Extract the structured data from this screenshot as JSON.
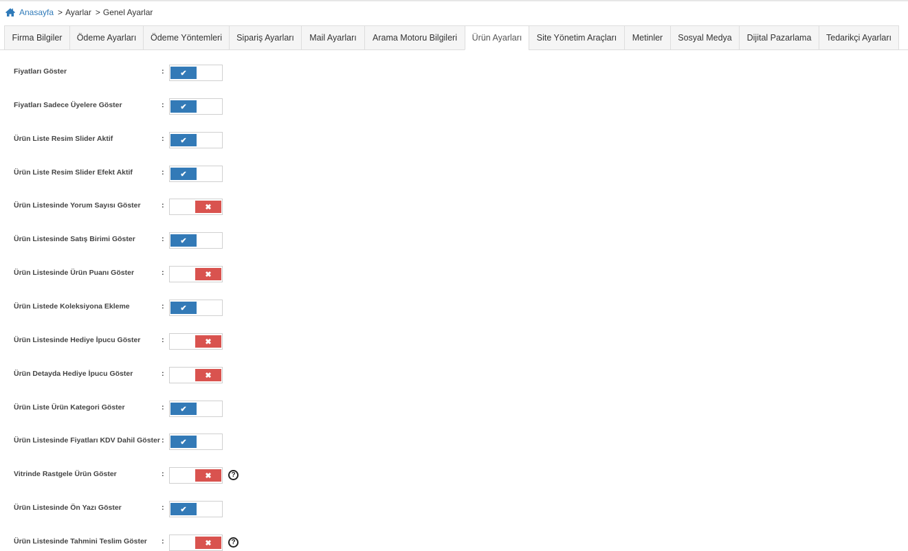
{
  "breadcrumb": {
    "home": "Anasayfa",
    "items": [
      "Ayarlar",
      "Genel Ayarlar"
    ]
  },
  "tabs": [
    {
      "label": "Firma Bilgiler",
      "width": 95
    },
    {
      "label": "Ödeme Ayarları",
      "width": 107
    },
    {
      "label": "Ödeme Yöntemleri",
      "width": 125
    },
    {
      "label": "Sipariş Ayarları",
      "width": 105
    },
    {
      "label": "Mail Ayarları",
      "width": 92
    },
    {
      "label": "Arama Motoru Bilgileri",
      "width": 146
    },
    {
      "label": "Ürün Ayarları",
      "width": 93,
      "active": true
    },
    {
      "label": "Site Yönetim Araçları",
      "width": 139
    },
    {
      "label": "Metinler",
      "width": 67
    },
    {
      "label": "Sosyal Medya",
      "width": 100
    },
    {
      "label": "Dijital Pazarlama",
      "width": 116
    },
    {
      "label": "Tedarikçi Ayarları",
      "width": 117
    }
  ],
  "colon": ":",
  "help_glyph": "?",
  "check_glyph": "✔",
  "cross_glyph": "✖",
  "settings": [
    {
      "label": "Fiyatları Göster",
      "on": true
    },
    {
      "label": "Fiyatları Sadece Üyelere Göster",
      "on": true
    },
    {
      "label": "Ürün Liste Resim Slider Aktif",
      "on": true
    },
    {
      "label": "Ürün Liste Resim Slider Efekt Aktif",
      "on": true
    },
    {
      "label": "Ürün Listesinde Yorum Sayısı Göster",
      "on": false
    },
    {
      "label": "Ürün Listesinde Satış Birimi Göster",
      "on": true
    },
    {
      "label": "Ürün Listesinde Ürün Puanı Göster",
      "on": false
    },
    {
      "label": "Ürün Listede Koleksiyona Ekleme",
      "on": true
    },
    {
      "label": "Ürün Listesinde Hediye İpucu Göster",
      "on": false
    },
    {
      "label": "Ürün Detayda Hediye İpucu Göster",
      "on": false
    },
    {
      "label": "Ürün Liste Ürün Kategori Göster",
      "on": true
    },
    {
      "label": "Ürün Listesinde Fiyatları KDV Dahil Göster",
      "on": true
    },
    {
      "label": "Vitrinde Rastgele Ürün Göster",
      "on": false,
      "help": true
    },
    {
      "label": "Ürün Listesinde Ön Yazı Göster",
      "on": true
    },
    {
      "label": "Ürün Listesinde Tahmini Teslim Göster",
      "on": false,
      "help": true
    }
  ],
  "colors": {
    "link": "#2f7ab9",
    "on": "#337ab7",
    "off": "#d9534f"
  }
}
